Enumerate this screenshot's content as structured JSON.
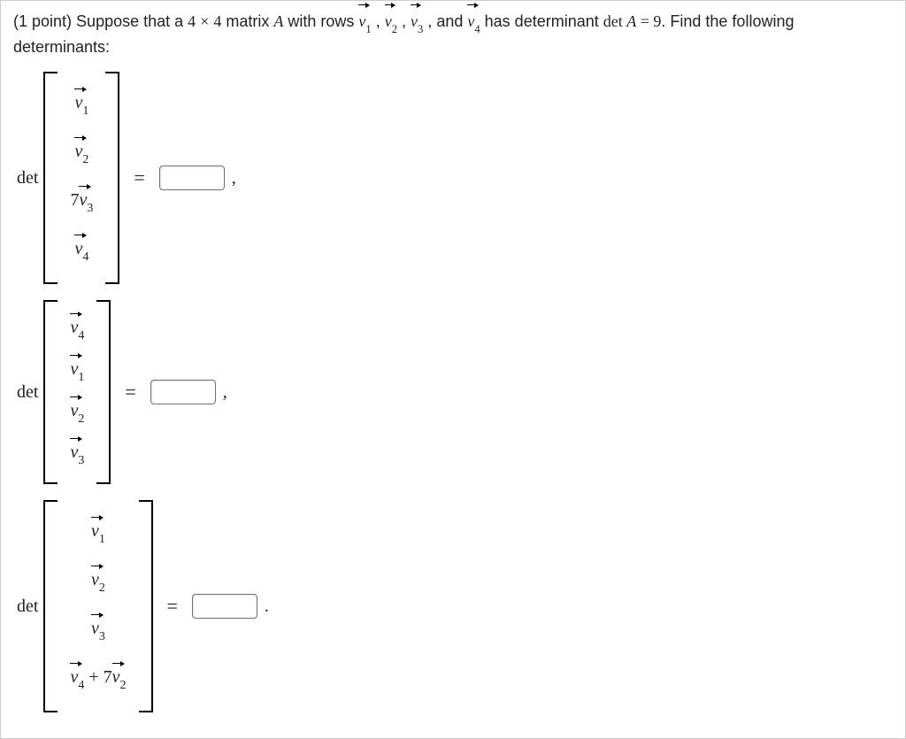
{
  "chart_data": {
    "type": "table",
    "title": "Determinant row-operation problems",
    "given": {
      "matrix_size": "4x4",
      "detA": 9
    },
    "problems": [
      {
        "rows": [
          "v1",
          "v2",
          "7*v3",
          "v4"
        ],
        "answer": null
      },
      {
        "rows": [
          "v4",
          "v1",
          "v2",
          "v3"
        ],
        "answer": null
      },
      {
        "rows": [
          "v1",
          "v2",
          "v3",
          "v4 + 7*v2"
        ],
        "answer": null
      }
    ]
  },
  "problem": {
    "points_label": "(1 point) ",
    "sentence_a": "Suppose that a ",
    "dim1": "4",
    "times": "×",
    "dim2": "4",
    "sentence_b": " matrix ",
    "matrix_name": "A",
    "sentence_c": " with rows ",
    "v1": "v",
    "v1_sub": "1",
    "sep1": " , ",
    "v2": "v",
    "v2_sub": "2",
    "sep2": " , ",
    "v3": "v",
    "v3_sub": "3",
    "sep3": " , and ",
    "v4": "v",
    "v4_sub": "4",
    "sentence_d": "  has determinant ",
    "det_text": "det ",
    "matrix_name2": "A",
    "eq": " = ",
    "det_val": "9",
    "sentence_e": ". Find the following determinants:"
  },
  "common": {
    "det": "det",
    "equals": "=",
    "comma": ",",
    "period": "."
  },
  "m1": {
    "r1a": "v",
    "r1s": "1",
    "r2a": "v",
    "r2s": "2",
    "r3coef": "7",
    "r3a": "v",
    "r3s": "3",
    "r4a": "v",
    "r4s": "4"
  },
  "m2": {
    "r1a": "v",
    "r1s": "4",
    "r2a": "v",
    "r2s": "1",
    "r3a": "v",
    "r3s": "2",
    "r4a": "v",
    "r4s": "3"
  },
  "m3": {
    "r1a": "v",
    "r1s": "1",
    "r2a": "v",
    "r2s": "2",
    "r3a": "v",
    "r3s": "3",
    "r4a": "v",
    "r4s": "4",
    "plus": " + ",
    "r4coef": "7",
    "r4b": "v",
    "r4bs": "2"
  }
}
